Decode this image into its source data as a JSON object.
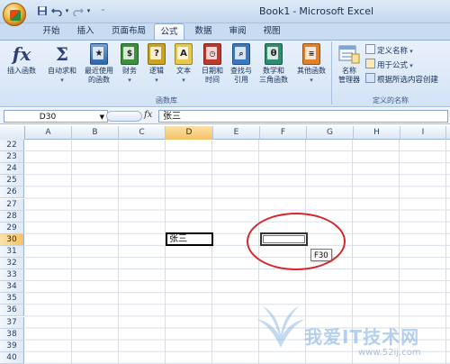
{
  "window": {
    "doc_name": "Book1",
    "separator": "-",
    "app_name": "Microsoft Excel"
  },
  "quick_access": {
    "save_icon": "save-icon",
    "undo_icon": "undo-icon",
    "redo_icon": "redo-icon",
    "customize_icon": "qat-dropdown-icon"
  },
  "tabs": [
    {
      "label": "开始",
      "active": false
    },
    {
      "label": "插入",
      "active": false
    },
    {
      "label": "页面布局",
      "active": false
    },
    {
      "label": "公式",
      "active": true
    },
    {
      "label": "数据",
      "active": false
    },
    {
      "label": "审阅",
      "active": false
    },
    {
      "label": "视图",
      "active": false
    }
  ],
  "ribbon": {
    "function_library": {
      "group_label": "函数库",
      "insert_function": "插入函数",
      "autosum": "自动求和",
      "recently_used_1": "最近使用",
      "recently_used_2": "的函数",
      "financial": "财务",
      "logical": "逻辑",
      "text": "文本",
      "datetime_1": "日期和",
      "datetime_2": "时间",
      "lookup_1": "查找与",
      "lookup_2": "引用",
      "math_1": "数学和",
      "math_2": "三角函数",
      "more": "其他函数"
    },
    "defined_names": {
      "group_label": "定义的名称",
      "name_manager_1": "名称",
      "name_manager_2": "管理器",
      "define_name": "定义名称",
      "use_in_formula": "用于公式",
      "create_from_selection": "根据所选内容创建"
    },
    "book_glyphs": {
      "logical": "?",
      "text": "A",
      "math": "θ"
    },
    "colors": {
      "financial": "#3d8f3d",
      "logical": "#c9a51e",
      "text": "#e6c84a",
      "datetime": "#c03a2b",
      "lookup": "#3a78c2",
      "math": "#2f8c6c",
      "more": "#e0822b"
    }
  },
  "formula_bar": {
    "name_box": "D30",
    "fx_label": "fx",
    "content": "张三"
  },
  "grid": {
    "columns": [
      "A",
      "B",
      "C",
      "D",
      "E",
      "F",
      "G",
      "H",
      "I"
    ],
    "selected_column": "D",
    "rows": [
      "22",
      "23",
      "24",
      "25",
      "26",
      "27",
      "28",
      "29",
      "30",
      "31",
      "32",
      "33",
      "34",
      "35",
      "36",
      "37",
      "38",
      "39",
      "40"
    ],
    "selected_row": "30",
    "cell_d30": "张三",
    "tooltip": "F30"
  },
  "watermark": {
    "text": "我爱IT技术网",
    "url": "www.52ij.com"
  },
  "accent_colors": {
    "selection": "#f4c266",
    "annotation_oval": "#d9262a"
  }
}
